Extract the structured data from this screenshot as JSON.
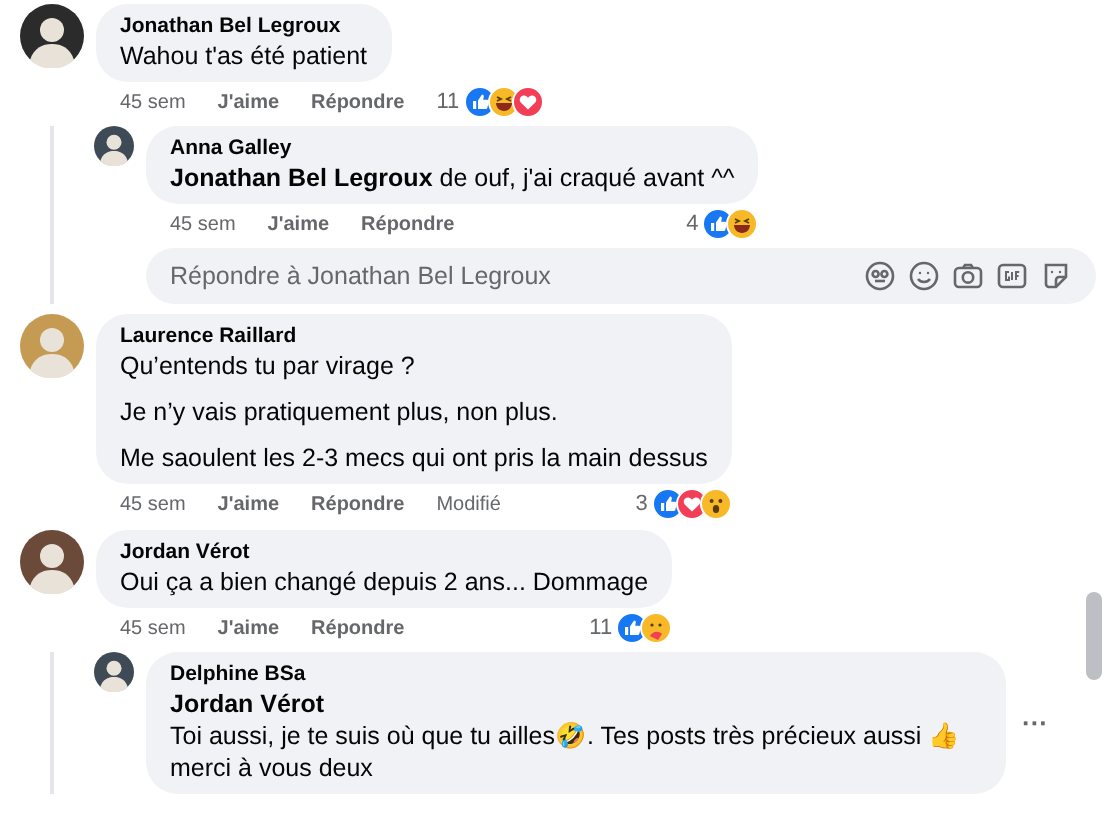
{
  "comments": [
    {
      "author": "Jonathan Bel Legroux",
      "paragraphs": [
        "Wahou t'as été patient"
      ],
      "time": "45 sem",
      "like": "J'aime",
      "reply": "Répondre",
      "reaction_count": "11",
      "reactions": [
        {
          "kind": "like"
        },
        {
          "kind": "haha"
        },
        {
          "kind": "love"
        }
      ],
      "replies": [
        {
          "author": "Anna Galley",
          "paragraphs": [
            "**Jonathan Bel Legroux** de ouf, j'ai craqué avant ^^"
          ],
          "time": "45 sem",
          "like": "J'aime",
          "reply": "Répondre",
          "reaction_count": "4",
          "reactions": [
            {
              "kind": "like"
            },
            {
              "kind": "haha"
            }
          ]
        }
      ],
      "reply_box": {
        "placeholder": "Répondre à Jonathan Bel Legroux"
      }
    },
    {
      "author": "Laurence Raillard",
      "paragraphs": [
        "Qu’entends tu par virage ?",
        "Je n’y vais pratiquement plus, non plus.",
        "Me saoulent les 2-3 mecs qui ont pris la main dessus"
      ],
      "time": "45 sem",
      "like": "J'aime",
      "reply": "Répondre",
      "edited": "Modifié",
      "reaction_count": "3",
      "reactions": [
        {
          "kind": "like"
        },
        {
          "kind": "love"
        },
        {
          "kind": "wow"
        }
      ]
    },
    {
      "author": "Jordan Vérot",
      "paragraphs": [
        "Oui ça a bien changé depuis 2 ans... Dommage"
      ],
      "time": "45 sem",
      "like": "J'aime",
      "reply": "Répondre",
      "reaction_count": "11",
      "reactions": [
        {
          "kind": "like"
        },
        {
          "kind": "care"
        }
      ],
      "replies": [
        {
          "author": "Delphine BSa",
          "mention": "Jordan Vérot",
          "paragraphs": [
            "Toi aussi, je te suis où que tu ailles🤣. Tes posts très précieux aussi 👍merci à vous deux"
          ],
          "more_options": "···"
        }
      ]
    }
  ]
}
